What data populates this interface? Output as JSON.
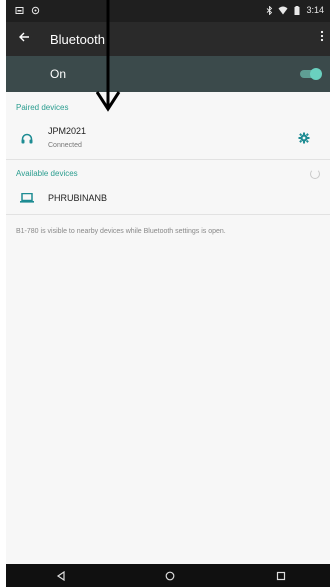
{
  "status_bar": {
    "time": "3:14"
  },
  "toolbar": {
    "title": "Bluetooth"
  },
  "master_switch": {
    "label": "On",
    "state": "on",
    "accent": "#6ad0bf"
  },
  "paired": {
    "header": "Paired devices",
    "header_color": "#2a9d8f",
    "devices": [
      {
        "name": "JPM2021",
        "status": "Connected",
        "icon": "headphones-icon"
      }
    ]
  },
  "available": {
    "header": "Available devices",
    "header_color": "#2a9d8f",
    "devices": [
      {
        "name": "PHRUBINANB",
        "icon": "laptop-icon"
      }
    ]
  },
  "visibility_note": "B1-780 is visible to nearby devices while Bluetooth settings is open.",
  "icons": {
    "status_left": [
      "notification-icon",
      "gallery-icon"
    ],
    "status_right": [
      "bluetooth-icon",
      "wifi-icon",
      "battery-icon"
    ],
    "nav": [
      "back-icon",
      "home-icon",
      "recents-icon"
    ]
  }
}
